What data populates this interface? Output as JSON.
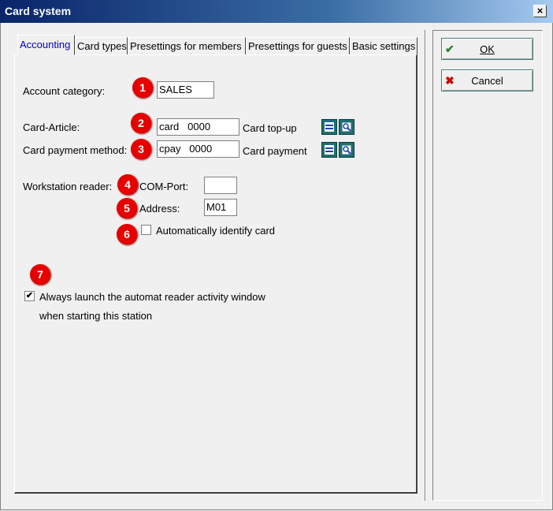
{
  "window": {
    "title": "Card system",
    "close_glyph": "×"
  },
  "tabs": [
    {
      "label": "Accounting"
    },
    {
      "label": "Card types"
    },
    {
      "label": "Presettings for members"
    },
    {
      "label": "Presettings for guests"
    },
    {
      "label": "Basic settings"
    }
  ],
  "accounting": {
    "account_category_label": "Account category:",
    "account_category_value": "SALES",
    "card_article_label": "Card-Article:",
    "card_article_value": "card   0000",
    "card_topup_label": "Card top-up",
    "card_payment_method_label": "Card payment method:",
    "card_payment_method_value": "cpay   0000",
    "card_payment_label": "Card payment",
    "workstation_reader_label": "Workstation reader:",
    "com_port_label": "COM-Port:",
    "com_port_value": "",
    "address_label": "Address:",
    "address_value": "M01",
    "auto_identify_label": "Automatically identify card",
    "auto_identify_checked": false,
    "launch_window_label_line1": "Always launch the automat reader activity window",
    "launch_window_label_line2": "when starting this station",
    "launch_window_checked": true,
    "check_glyph": "✔"
  },
  "badges": [
    "1",
    "2",
    "3",
    "4",
    "5",
    "6",
    "7"
  ],
  "buttons": {
    "ok_label": "OK",
    "cancel_label": "Cancel",
    "ok_icon": "✔",
    "cancel_icon": "✖"
  },
  "colors": {
    "badge": "#e60000",
    "tab_active": "#0000c0",
    "title_bar": "#0a246a"
  }
}
